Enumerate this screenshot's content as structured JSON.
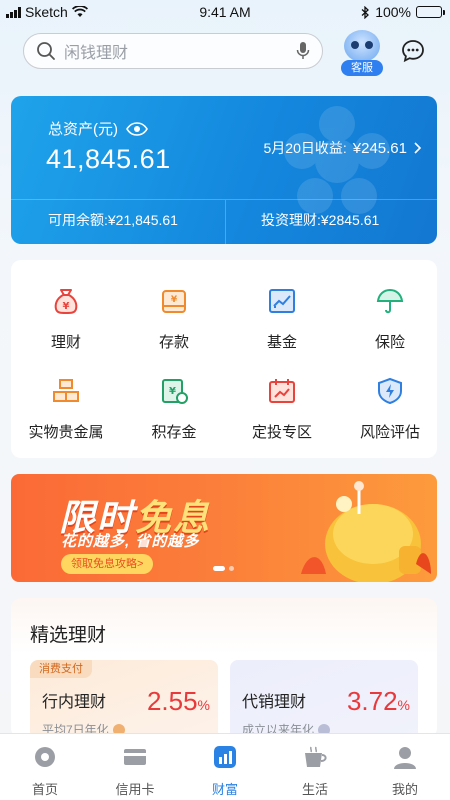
{
  "status_bar": {
    "carrier": "Sketch",
    "time": "9:41 AM",
    "battery": "100%"
  },
  "search": {
    "placeholder": "闲钱理财",
    "icon": "search-icon",
    "voice_icon": "microphone-icon"
  },
  "customer_service": {
    "label": "客服"
  },
  "chat": {
    "icon": "chat-bubble-icon"
  },
  "asset": {
    "label": "总资产(元)",
    "value": "41,845.61",
    "yield_label": "5月20日收益:",
    "yield_value": "¥245.61",
    "available_label": "可用余额:",
    "available_value": "¥21,845.61",
    "invest_label": "投资理财:",
    "invest_value": "¥2845.61"
  },
  "menu": {
    "items": [
      {
        "label": "理财",
        "icon": "money-bag-icon",
        "color": "#e8433c"
      },
      {
        "label": "存款",
        "icon": "deposit-box-icon",
        "color": "#f08a2c"
      },
      {
        "label": "基金",
        "icon": "fund-chart-icon",
        "color": "#2f7fe0"
      },
      {
        "label": "保险",
        "icon": "umbrella-icon",
        "color": "#22b07d"
      },
      {
        "label": "实物贵金属",
        "icon": "gold-bars-icon",
        "color": "#f08a2c"
      },
      {
        "label": "积存金",
        "icon": "gold-savings-icon",
        "color": "#22a066"
      },
      {
        "label": "定投专区",
        "icon": "trend-calendar-icon",
        "color": "#e8433c"
      },
      {
        "label": "风险评估",
        "icon": "shield-bolt-icon",
        "color": "#2f7fe0"
      }
    ]
  },
  "banner": {
    "title_a": "限时",
    "title_b": "免息",
    "subtitle": "花的越多, 省的越多",
    "button": "领取免息攻略>"
  },
  "selected": {
    "title": "精选理财",
    "products": [
      {
        "tag": "消费支付",
        "name": "行内理财",
        "rate": "2.55",
        "unit": "%",
        "note": "平均7日年化"
      },
      {
        "name": "代销理财",
        "rate": "3.72",
        "unit": "%",
        "note": "成立以来年化"
      }
    ]
  },
  "tabs": [
    {
      "label": "首页",
      "icon": "home-gear-icon"
    },
    {
      "label": "信用卡",
      "icon": "credit-card-icon"
    },
    {
      "label": "财富",
      "icon": "wealth-chart-icon",
      "active": true
    },
    {
      "label": "生活",
      "icon": "coffee-cup-icon"
    },
    {
      "label": "我的",
      "icon": "user-icon"
    }
  ],
  "colors": {
    "accent": "#2a82e4",
    "rate": "#e8393c",
    "banner": "#fb6a36"
  }
}
